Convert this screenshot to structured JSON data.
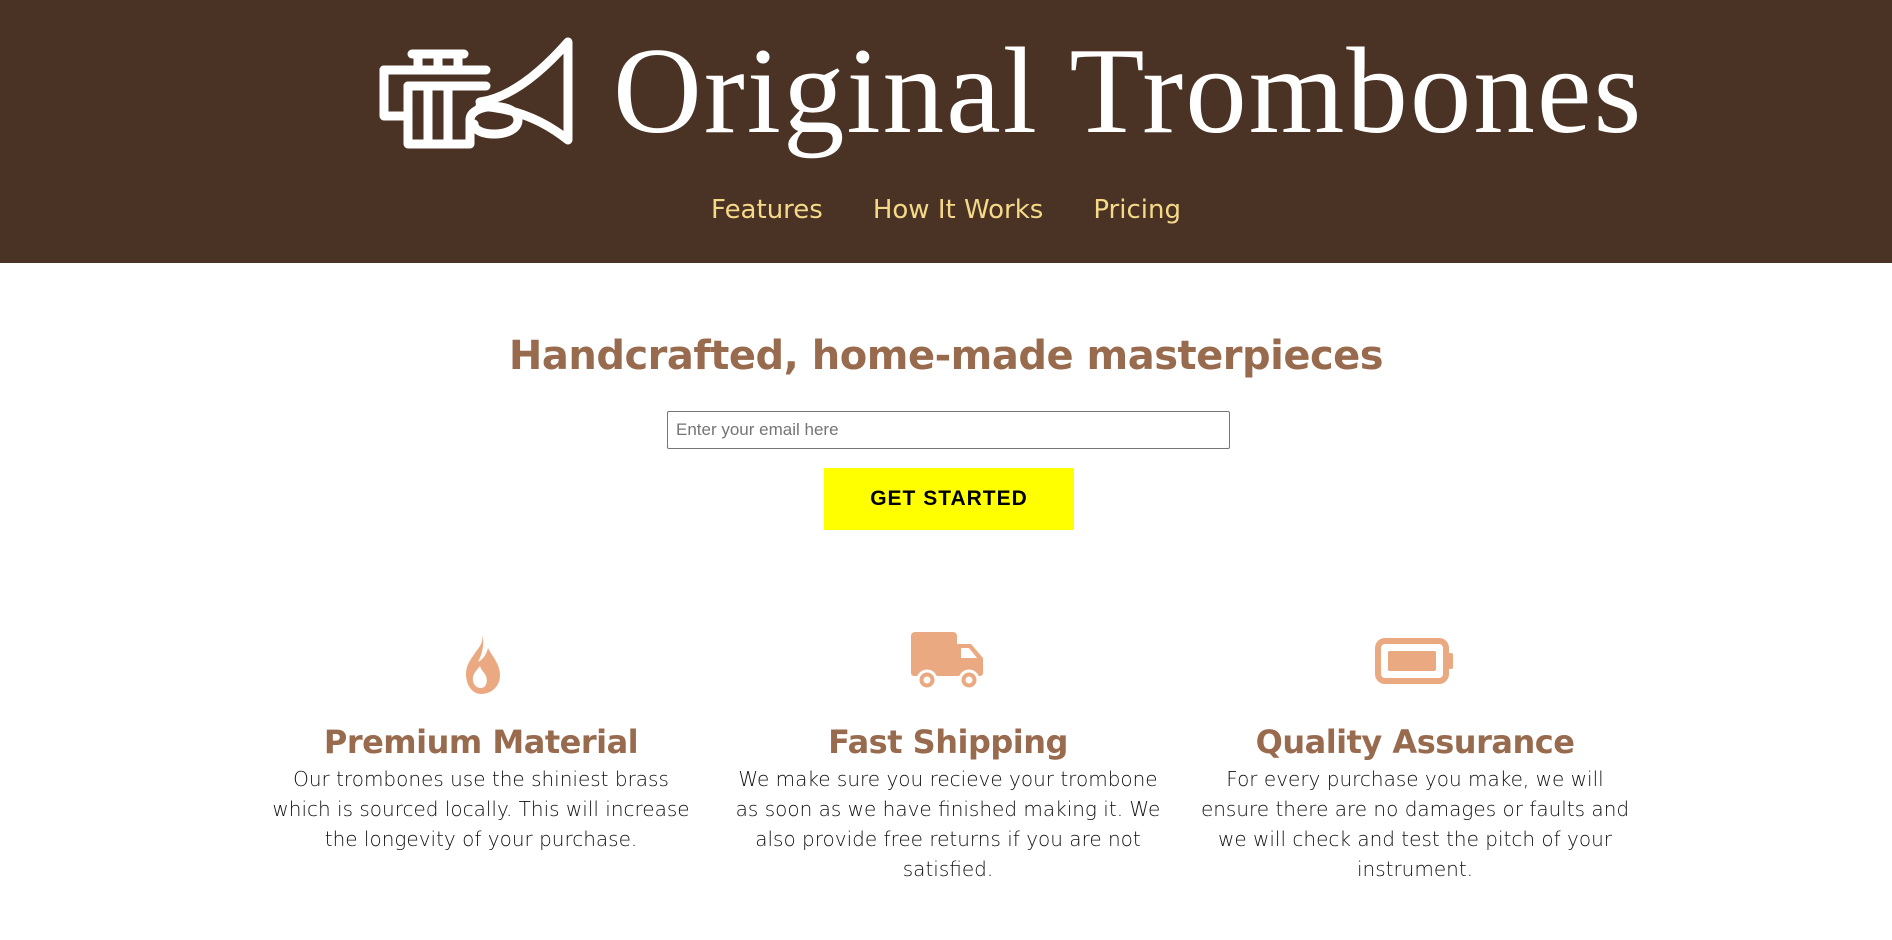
{
  "header": {
    "brand_title": "Original Trombones",
    "logo_icon": "trombone-icon",
    "nav": [
      {
        "label": "Features"
      },
      {
        "label": "How It Works"
      },
      {
        "label": "Pricing"
      }
    ]
  },
  "hero": {
    "heading": "Handcrafted, home-made masterpieces",
    "email_placeholder": "Enter your email here",
    "email_value": "",
    "cta_label": "GET STARTED"
  },
  "features": [
    {
      "icon": "fire-icon",
      "title": "Premium Material",
      "text": "Our trombones use the shiniest brass which is sourced locally. This will increase the longevity of your purchase."
    },
    {
      "icon": "truck-icon",
      "title": "Fast Shipping",
      "text": "We make sure you recieve your trombone as soon as we have finished making it. We also provide free returns if you are not satisfied."
    },
    {
      "icon": "battery-full-icon",
      "title": "Quality Assurance",
      "text": "For every purchase you make, we will ensure there are no damages or faults and we will check and test the pitch of your instrument."
    }
  ],
  "colors": {
    "header_bg": "#4a3324",
    "nav_link": "#f5d989",
    "heading": "#986b4e",
    "icon": "#eba982",
    "cta_bg": "#ffff00"
  }
}
